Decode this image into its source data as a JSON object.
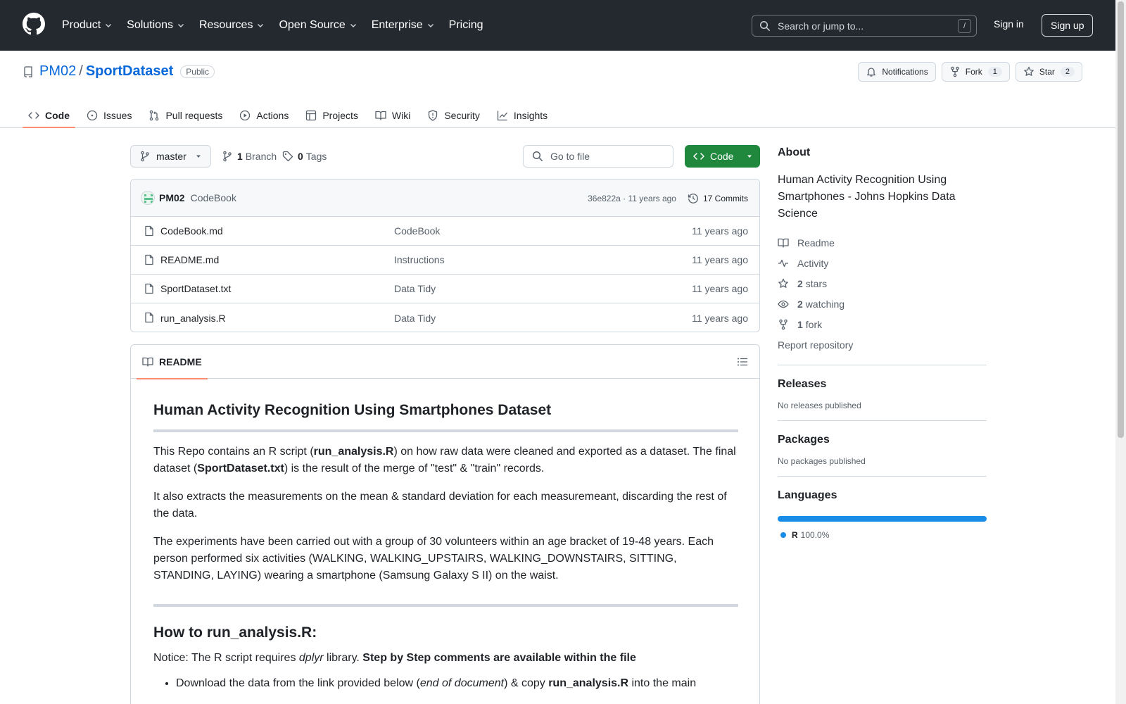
{
  "header": {
    "nav": [
      "Product",
      "Solutions",
      "Resources",
      "Open Source",
      "Enterprise",
      "Pricing"
    ],
    "search_placeholder": "Search or jump to...",
    "search_shortcut": "/",
    "sign_in": "Sign in",
    "sign_up": "Sign up"
  },
  "repo": {
    "owner": "PM02",
    "separator": "/",
    "name": "SportDataset",
    "visibility": "Public",
    "notifications_label": "Notifications",
    "fork_label": "Fork",
    "fork_count": "1",
    "star_label": "Star",
    "star_count": "2"
  },
  "tabs": [
    "Code",
    "Issues",
    "Pull requests",
    "Actions",
    "Projects",
    "Wiki",
    "Security",
    "Insights"
  ],
  "toolbar": {
    "branch": "master",
    "branch_count": "1",
    "branch_label": "Branch",
    "tag_count": "0",
    "tag_label": "Tags",
    "goto_file": "Go to file",
    "code_button": "Code"
  },
  "commit": {
    "author": "PM02",
    "message": "CodeBook",
    "hash_time": "36e822a · 11 years ago",
    "commits": "17 Commits"
  },
  "files": [
    {
      "name": "CodeBook.md",
      "message": "CodeBook",
      "age": "11 years ago"
    },
    {
      "name": "README.md",
      "message": "Instructions",
      "age": "11 years ago"
    },
    {
      "name": "SportDataset.txt",
      "message": "Data Tidy",
      "age": "11 years ago"
    },
    {
      "name": "run_analysis.R",
      "message": "Data Tidy",
      "age": "11 years ago"
    }
  ],
  "readme": {
    "tab_label": "README",
    "h1": "Human Activity Recognition Using Smartphones Dataset",
    "p1_a": "This Repo contains an R script (",
    "p1_b": "run_analysis.R",
    "p1_c": ") on how raw data were cleaned and exported as a dataset. The final dataset (",
    "p1_d": "SportDataset.txt",
    "p1_e": ") is the result of the merge of \"test\" & \"train\" records.",
    "p2": "It also extracts the measurements on the mean & standard deviation for each measuremeant, discarding the rest of the data.",
    "p3": "The experiments have been carried out with a group of 30 volunteers within an age bracket of 19-48 years. Each person performed six activities (WALKING, WALKING_UPSTAIRS, WALKING_DOWNSTAIRS, SITTING, STANDING, LAYING) wearing a smartphone (Samsung Galaxy S II) on the waist.",
    "h2": "How to run_analysis.R:",
    "p4_a": "Notice: The R script requires ",
    "p4_b": "dplyr",
    "p4_c": " library. ",
    "p4_d": "Step by Step comments are available within the file",
    "li1_a": "Download the data from the link provided below (",
    "li1_b": "end of document",
    "li1_c": ") & copy ",
    "li1_d": "run_analysis.R",
    "li1_e": " into the main"
  },
  "sidebar": {
    "about_title": "About",
    "description": "Human Activity Recognition Using Smartphones - Johns Hopkins Data Science",
    "readme": "Readme",
    "activity": "Activity",
    "stars_count": "2",
    "stars_label": "stars",
    "watching_count": "2",
    "watching_label": "watching",
    "fork_count": "1",
    "fork_label": "fork",
    "report": "Report repository",
    "releases_title": "Releases",
    "releases_text": "No releases published",
    "packages_title": "Packages",
    "packages_text": "No packages published",
    "languages_title": "Languages",
    "languages": [
      {
        "name": "R",
        "percent": "100.0%",
        "share": 1.0,
        "color": "#198ce7"
      }
    ]
  }
}
